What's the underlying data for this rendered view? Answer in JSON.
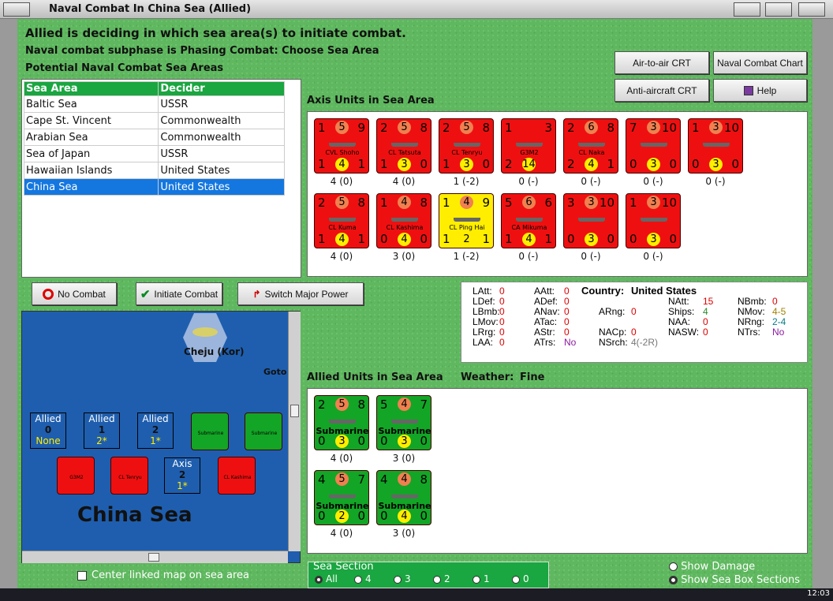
{
  "window": {
    "title": "Naval Combat In China Sea (Allied)"
  },
  "instructions": {
    "line1": "Allied is deciding in which sea area(s) to initiate combat.",
    "line2": "Naval combat subphase is Phasing Combat: Choose Sea Area",
    "line3": "Potential Naval Combat Sea Areas"
  },
  "buttons": {
    "air_to_air": "Air-to-air CRT",
    "naval_chart": "Naval Combat Chart",
    "anti_aircraft": "Anti-aircraft CRT",
    "help": "Help",
    "no_combat": "No Combat",
    "initiate": "Initiate Combat",
    "switch": "Switch Major Power"
  },
  "sea_table": {
    "headers": [
      "Sea Area",
      "Decider"
    ],
    "rows": [
      {
        "area": "Baltic Sea",
        "decider": "USSR"
      },
      {
        "area": "Cape St. Vincent",
        "decider": "Commonwealth"
      },
      {
        "area": "Arabian Sea",
        "decider": "Commonwealth"
      },
      {
        "area": "Sea of Japan",
        "decider": "USSR"
      },
      {
        "area": "Hawaiian Islands",
        "decider": "United States"
      },
      {
        "area": "China Sea",
        "decider": "United States"
      }
    ]
  },
  "axis": {
    "label": "Axis Units in Sea Area",
    "units": [
      {
        "name": "CVL Shoho",
        "tl": "1",
        "tc": "5",
        "tr": "9",
        "bl": "1",
        "bc": "4",
        "br": "1",
        "stat": "4 (0)",
        "color": "red"
      },
      {
        "name": "CL Tatsuta",
        "tl": "2",
        "tc": "5",
        "tr": "8",
        "bl": "1",
        "bc": "3",
        "br": "0",
        "stat": "4 (0)",
        "color": "red"
      },
      {
        "name": "CL Tenryu",
        "tl": "2",
        "tc": "5",
        "tr": "8",
        "bl": "1",
        "bc": "3",
        "br": "0",
        "stat": "1 (-2)",
        "color": "red"
      },
      {
        "name": "G3M2",
        "tl": "1",
        "tc": "",
        "tr": "3",
        "bl": "2",
        "bc": "14",
        "br": "",
        "stat": "0 (-)",
        "color": "red"
      },
      {
        "name": "CL Naka",
        "tl": "2",
        "tc": "6",
        "tr": "8",
        "bl": "2",
        "bc": "4",
        "br": "1",
        "stat": "0 (-)",
        "color": "red"
      },
      {
        "name": "",
        "tl": "7",
        "tc": "3",
        "tr": "10",
        "bl": "0",
        "bc": "3",
        "br": "0",
        "stat": "0 (-)",
        "color": "red"
      },
      {
        "name": "",
        "tl": "1",
        "tc": "3",
        "tr": "10",
        "bl": "0",
        "bc": "3",
        "br": "0",
        "stat": "0 (-)",
        "color": "red"
      },
      {
        "name": "CL Kuma",
        "tl": "2",
        "tc": "5",
        "tr": "8",
        "bl": "1",
        "bc": "4",
        "br": "1",
        "stat": "4 (0)",
        "color": "red"
      },
      {
        "name": "CL Kashima",
        "tl": "1",
        "tc": "4",
        "tr": "8",
        "bl": "0",
        "bc": "4",
        "br": "0",
        "stat": "3 (0)",
        "color": "red"
      },
      {
        "name": "CL Ping Hai",
        "tl": "1",
        "tc": "4",
        "tr": "9",
        "bl": "1",
        "bc": "2",
        "br": "1",
        "stat": "1 (-2)",
        "color": "yel"
      },
      {
        "name": "CA Mikuma",
        "tl": "5",
        "tc": "6",
        "tr": "6",
        "bl": "1",
        "bc": "4",
        "br": "1",
        "stat": "0 (-)",
        "color": "red"
      },
      {
        "name": "",
        "tl": "3",
        "tc": "3",
        "tr": "10",
        "bl": "0",
        "bc": "3",
        "br": "0",
        "stat": "0 (-)",
        "color": "red"
      },
      {
        "name": "",
        "tl": "1",
        "tc": "3",
        "tr": "10",
        "bl": "0",
        "bc": "3",
        "br": "0",
        "stat": "0 (-)",
        "color": "red"
      }
    ]
  },
  "allied": {
    "label": "Allied Units in Sea Area",
    "weather_label": "Weather:",
    "weather": "Fine",
    "units": [
      {
        "name": "Submarine",
        "tl": "2",
        "tc": "5",
        "tr": "8",
        "bl": "0",
        "bc": "3",
        "br": "0",
        "stat": "4 (0)"
      },
      {
        "name": "Submarine",
        "tl": "5",
        "tc": "4",
        "tr": "7",
        "bl": "0",
        "bc": "3",
        "br": "0",
        "stat": "3 (0)"
      },
      {
        "name": "Submarine",
        "tl": "4",
        "tc": "5",
        "tr": "7",
        "bl": "0",
        "bc": "2",
        "br": "0",
        "stat": "4 (0)"
      },
      {
        "name": "Submarine",
        "tl": "4",
        "tc": "4",
        "tr": "8",
        "bl": "0",
        "bc": "4",
        "br": "0",
        "stat": "3 (0)"
      }
    ]
  },
  "stats": {
    "country_label": "Country:",
    "country": "United States",
    "col1": [
      [
        "LAtt:",
        "0"
      ],
      [
        "LDef:",
        "0"
      ],
      [
        "LBmb:",
        "0"
      ],
      [
        "LMov:",
        "0"
      ],
      [
        "LRrg:",
        "0"
      ],
      [
        "LAA:",
        "0"
      ]
    ],
    "col2": [
      [
        "AAtt:",
        "0"
      ],
      [
        "ADef:",
        "0"
      ],
      [
        "ANav:",
        "0"
      ],
      [
        "ATac:",
        "0"
      ],
      [
        "AStr:",
        "0"
      ],
      [
        "ATrs:",
        "No"
      ]
    ],
    "col3": [
      [
        "ARng:",
        "0"
      ],
      [
        "NACp:",
        "0"
      ],
      [
        "NSrch:",
        "4(-2R)"
      ]
    ],
    "col4": [
      [
        "NAtt:",
        "15"
      ],
      [
        "Ships:",
        "4"
      ],
      [
        "NAA:",
        "0"
      ],
      [
        "NASW:",
        "0"
      ]
    ],
    "col5": [
      [
        "NBmb:",
        "0"
      ],
      [
        "NMov:",
        "4-5"
      ],
      [
        "NRng:",
        "2-4"
      ],
      [
        "NTrs:",
        "No"
      ]
    ]
  },
  "map": {
    "hex_label": "Cheju (Kor)",
    "goto": "Goto",
    "sea_name": "China Sea",
    "boxes": [
      {
        "side": "Allied",
        "n": "0",
        "v": "None"
      },
      {
        "side": "Allied",
        "n": "1",
        "v": "2*"
      },
      {
        "side": "Allied",
        "n": "2",
        "v": "1*"
      },
      {
        "side": "Axis",
        "n": "2",
        "v": "1*"
      }
    ],
    "unit_names": [
      "Submarine",
      "Submarine",
      "G3M2",
      "CL Tenryu",
      "CL Kashima"
    ]
  },
  "checkboxes": {
    "center_map": "Center linked map on sea area"
  },
  "sea_section": {
    "label": "Sea Section",
    "options": [
      "All",
      "4",
      "3",
      "2",
      "1",
      "0"
    ]
  },
  "radios": {
    "show_damage": "Show Damage",
    "show_boxes": "Show Sea Box Sections"
  },
  "clock": "12:03"
}
